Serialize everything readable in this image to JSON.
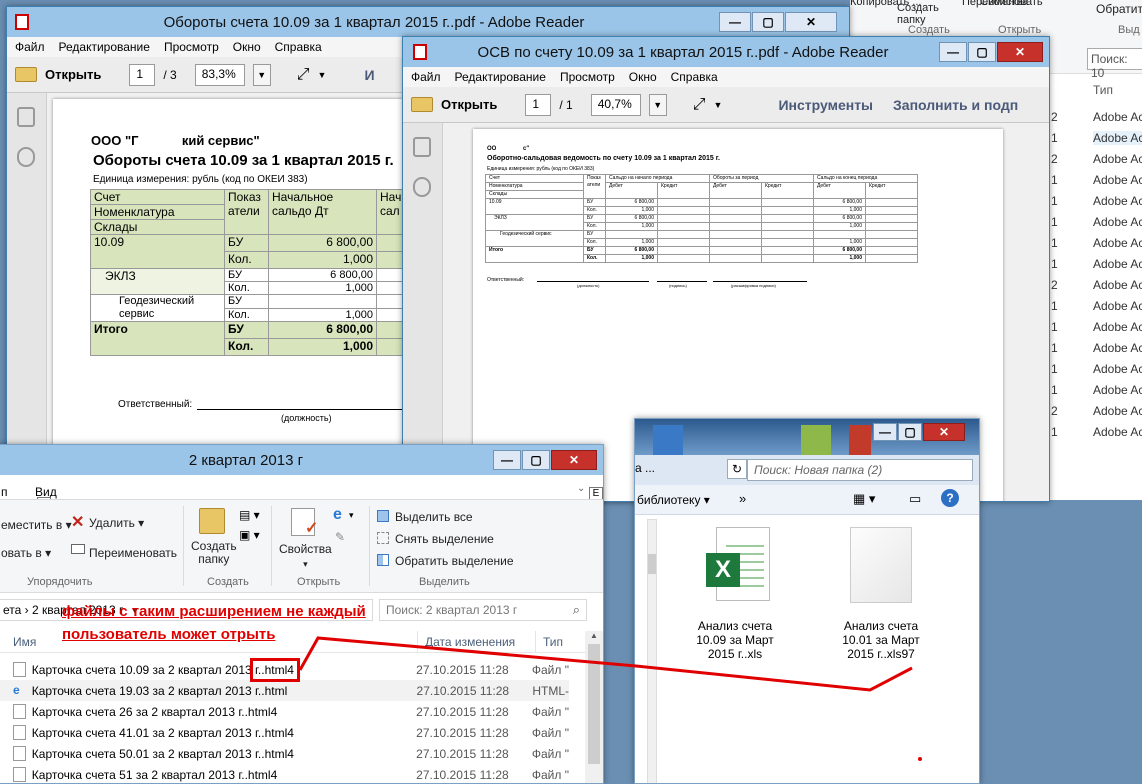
{
  "bg_explorer": {
    "top_items": [
      "Копировать ...",
      "Копировать в",
      "Переименовать"
    ],
    "ribbon": [
      "Создать папку",
      "Свойства",
      "Обратить"
    ],
    "group_labels": [
      "Создать",
      "Открыть",
      "Выд"
    ],
    "search_placeholder": "Поиск: 10",
    "col_type": "Тип",
    "rows": [
      {
        "n": "2",
        "t": "Adobe Ac"
      },
      {
        "n": "1",
        "t": "Adobe Ac"
      },
      {
        "n": "2",
        "t": "Adobe Ac"
      },
      {
        "n": "1",
        "t": "Adobe Ac"
      },
      {
        "n": "1",
        "t": "Adobe Ac"
      },
      {
        "n": "1",
        "t": "Adobe Ac"
      },
      {
        "n": "1",
        "t": "Adobe Ac"
      },
      {
        "n": "1",
        "t": "Adobe Ac"
      },
      {
        "n": "2",
        "t": "Adobe Ac"
      },
      {
        "n": "1",
        "t": "Adobe Ac"
      },
      {
        "n": "1",
        "t": "Adobe Ac"
      },
      {
        "n": "1",
        "t": "Adobe Ac"
      },
      {
        "n": "1",
        "t": "Adobe Ac"
      },
      {
        "n": "1",
        "t": "Adobe Ac"
      },
      {
        "n": "2",
        "t": "Adobe Ac"
      },
      {
        "n": "1",
        "t": "Adobe Ac"
      }
    ]
  },
  "reader1": {
    "title": "Обороты счета 10.09 за 1 квартал 2015 г..pdf - Adobe Reader",
    "menu": [
      "Файл",
      "Редактирование",
      "Просмотр",
      "Окно",
      "Справка"
    ],
    "open": "Открыть",
    "page": "1",
    "pages": "/ 3",
    "zoom": "83,3%",
    "tools_cut": "И",
    "org": "ООО \"Г            кий сервис\"",
    "heading": "Обороты счета 10.09 за 1 квартал 2015 г.",
    "units": "Единица измерения:   рубль (код по ОКЕИ 383)",
    "h_schet": "Счет",
    "h_nomen": "Номенклатура",
    "h_skl": "Склады",
    "h_pok1": "Показ",
    "h_pok2": "атели",
    "h_nach1": "Начальное",
    "h_nach2": "сальдо Дт",
    "h_na1": "Нач",
    "h_na2": "сал",
    "r_1009": "10.09",
    "r_eklz": "ЭКЛЗ",
    "r_geo1": "Геодезический",
    "r_geo2": "сервис",
    "r_itogo": "Итого",
    "bu": "БУ",
    "kol": "Кол.",
    "v6800": "6 800,00",
    "v1000": "1,000",
    "resp": "Ответственный:",
    "dolzh": "(должность)"
  },
  "reader2": {
    "title": "ОСВ по счету 10.09 за 1 квартал 2015 г..pdf - Adobe Reader",
    "menu": [
      "Файл",
      "Редактирование",
      "Просмотр",
      "Окно",
      "Справка"
    ],
    "open": "Открыть",
    "page": "1",
    "pages": "/ 1",
    "zoom": "40,7%",
    "tools": "Инструменты",
    "fill": "Заполнить и подп",
    "org": "ОО                с\"",
    "heading": "Оборотно-сальдовая ведомость по счету 10.09 за 1 квартал 2015 г.",
    "units": "Единица измерения:   рубль (код по ОКЕИ 383)",
    "cols": [
      "Счет",
      "Показ атели",
      "Сальдо на начало периода",
      "Обороты за период",
      "Сальдо на конец периода"
    ],
    "sub": [
      "Номенклатура",
      "Склады",
      "Дебет",
      "Кредит"
    ],
    "rows": [
      "10.09",
      "ЭКЛЗ",
      "Геодезический сервис",
      "Итого"
    ],
    "bu": "БУ",
    "kol": "Кол.",
    "v6800": "6 800,00",
    "v1000": "1,000",
    "resp": "Ответственный:",
    "sig": [
      "(должность)",
      "(подпись)",
      "(расшифровка подписи)"
    ]
  },
  "explorer_small": {
    "search": "Поиск: Новая папка (2)",
    "lib": "библиотеку",
    "files": [
      {
        "name": "Анализ счета 10.09 за Март 2015 г..xls",
        "l1": "Анализ счета",
        "l2": "10.09 за Март",
        "l3": "2015 г..xls"
      },
      {
        "name": "Анализ счета 10.01 за Март 2015 г..xls97",
        "l1": "Анализ счета",
        "l2": "10.01 за Март",
        "l3": "2015 г..xls97"
      }
    ]
  },
  "explorer_main": {
    "title": "2 квартал 2013 г",
    "tabs": [
      "п",
      "Вид"
    ],
    "ribbon_move": "еместить в",
    "ribbon_copy": "овать в",
    "ribbon_delete": "Удалить",
    "ribbon_rename": "Переименовать",
    "ribbon_newfolder1": "Создать",
    "ribbon_newfolder2": "папку",
    "ribbon_props": "Свойства",
    "ribbon_selall": "Выделить все",
    "ribbon_selnone": "Снять выделение",
    "ribbon_selinv": "Обратить выделение",
    "grp": [
      "Упорядочить",
      "Создать",
      "Открыть",
      "Выделить"
    ],
    "address": [
      "ета",
      "2 квартал 2013 г"
    ],
    "search": "Поиск: 2 квартал 2013 г",
    "col_name": "Имя",
    "col_date": "Дата изменения",
    "col_type": "Тип",
    "files": [
      {
        "name": "Карточка счета 10.09 за 2 квартал 2013 г..html4",
        "date": "27.10.2015 11:28",
        "type": "Файл \""
      },
      {
        "name": "Карточка счета 19.03 за 2 квартал 2013 г..html",
        "date": "27.10.2015 11:28",
        "type": "HTML-"
      },
      {
        "name": "Карточка счета 26 за 2 квартал 2013 г..html4",
        "date": "27.10.2015 11:28",
        "type": "Файл \""
      },
      {
        "name": "Карточка счета 41.01 за 2 квартал 2013 г..html4",
        "date": "27.10.2015 11:28",
        "type": "Файл \""
      },
      {
        "name": "Карточка счета 50.01 за 2 квартал 2013 г..html4",
        "date": "27.10.2015 11:28",
        "type": "Файл \""
      },
      {
        "name": "Карточка счета 51 за 2 квартал 2013 г..html4",
        "date": "27.10.2015 11:28",
        "type": "Файл \""
      }
    ]
  },
  "annotation": {
    "line1": "файлы с таким расширением не каждый",
    "line2": "пользователь может отрыть",
    "color": "#e00000"
  }
}
